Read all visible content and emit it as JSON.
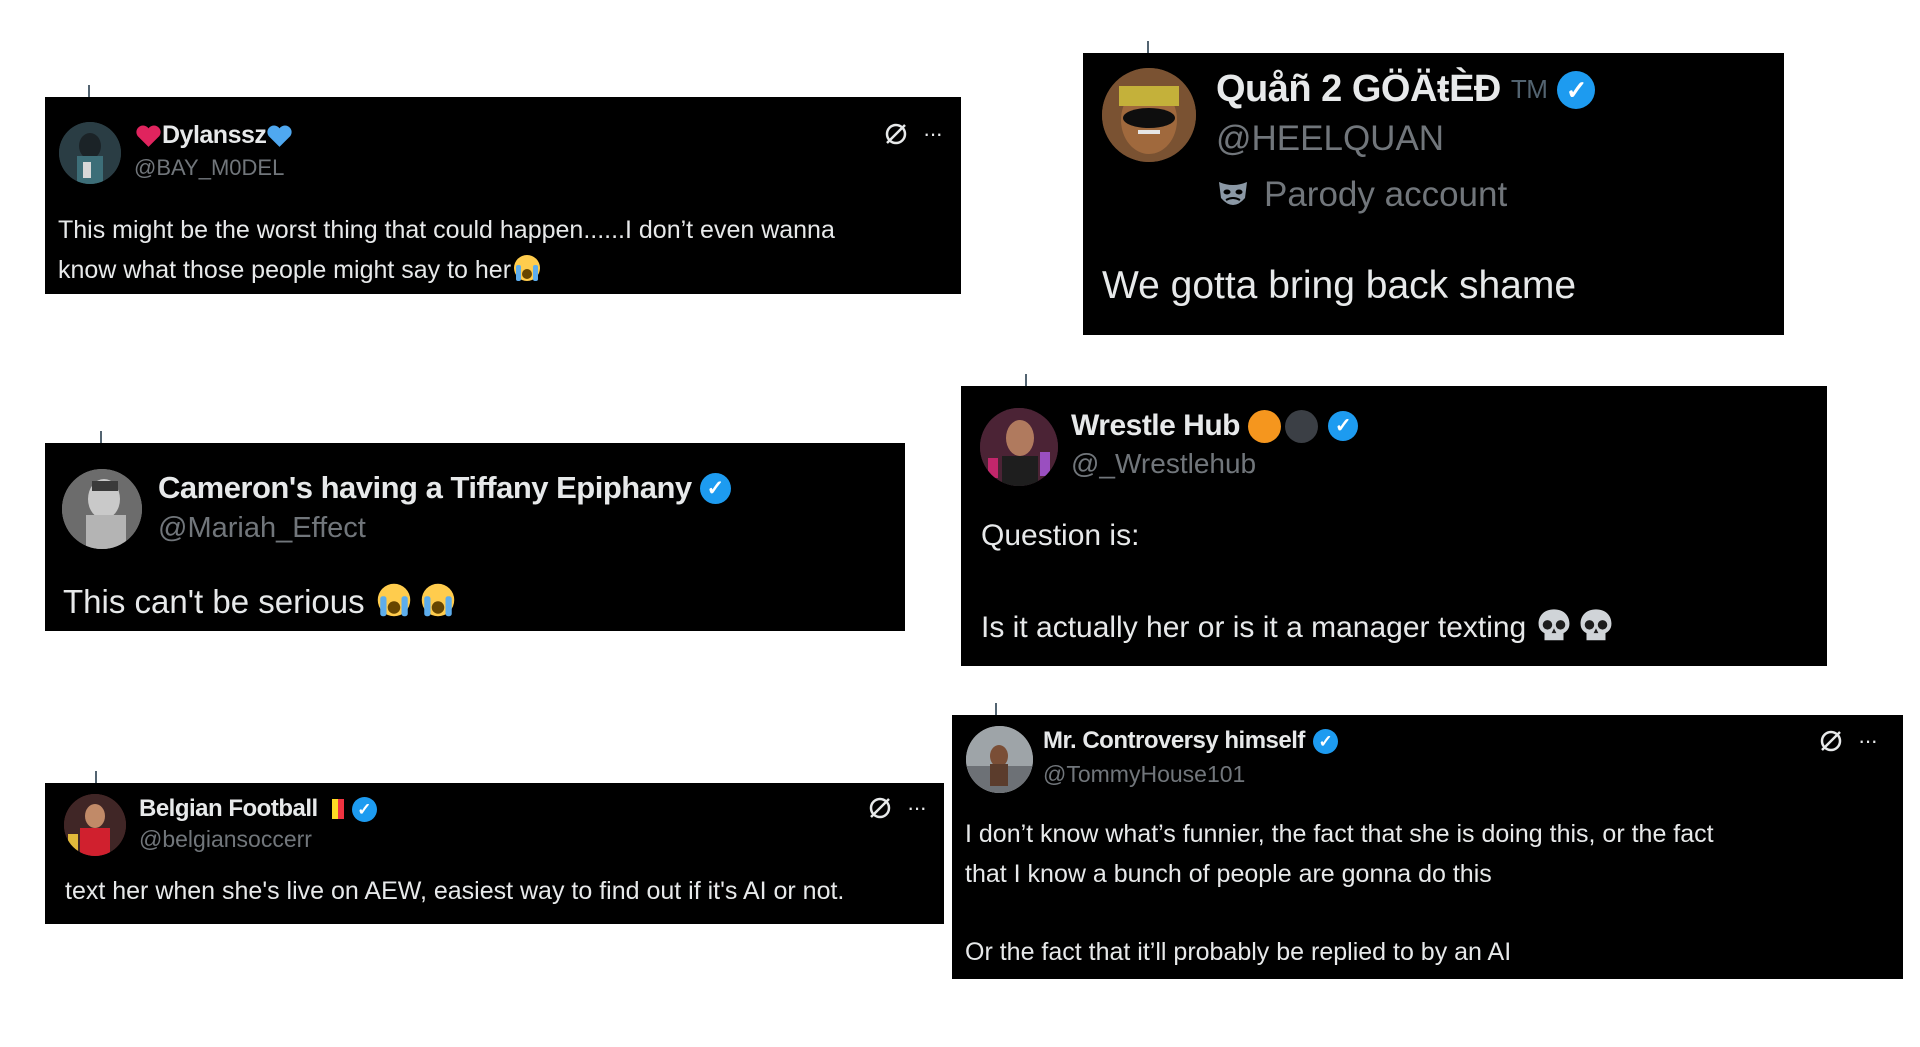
{
  "tweets": [
    {
      "name": "Dylanssz",
      "handle": "@BAY_M0DEL",
      "text_lines": [
        "This might be the worst thing that could happen......I don’t even wanna",
        "know what those people might say to her"
      ],
      "avatar_icon": "avatar-photo",
      "action_icons": [
        "grok-icon",
        "more-icon"
      ]
    },
    {
      "name": "Quåñ 2 GÖÄŧÈÐ",
      "name_suffix": "TM",
      "handle": "@HEELQUAN",
      "parody_label": "Parody account",
      "text_lines": [
        "We gotta bring back shame"
      ],
      "verified": true
    },
    {
      "name": "Cameron's having a Tiffany Epiphany",
      "handle": "@Mariah_Effect",
      "text_lines": [
        "This can't be serious "
      ],
      "verified": true
    },
    {
      "name": "Wrestle Hub",
      "handle": "@_Wrestlehub",
      "text_lines": [
        "Question is:",
        "",
        "Is it actually her or is it a manager texting "
      ],
      "verified": true
    },
    {
      "name": "Belgian Football",
      "handle": "@belgiansoccerr",
      "text_lines": [
        "text her when she's live on AEW, easiest way to find out if it's AI or not."
      ],
      "verified": true
    },
    {
      "name": "Mr. Controversy himself",
      "handle": "@TommyHouse101",
      "text_lines": [
        "I don’t know what’s funnier, the fact that she is doing this, or the fact",
        "that I know a bunch of people are gonna do this",
        "",
        "Or the fact that it’ll probably be replied to by an AI"
      ],
      "verified": true
    }
  ],
  "more_glyph": "···",
  "verified_glyph": "✓",
  "colors": {
    "card_bg": "#000000",
    "text": "#e7e9ea",
    "handle": "#71767b",
    "verified": "#1d9bf0",
    "heart_red": "#e0245e",
    "heart_blue": "#4fa8f0",
    "wrestle_orange": "#f5961e",
    "wrestle_dark": "#3b3f45",
    "belgium_black": "#000000",
    "belgium_yellow": "#fdda24",
    "belgium_red": "#ef3340"
  }
}
